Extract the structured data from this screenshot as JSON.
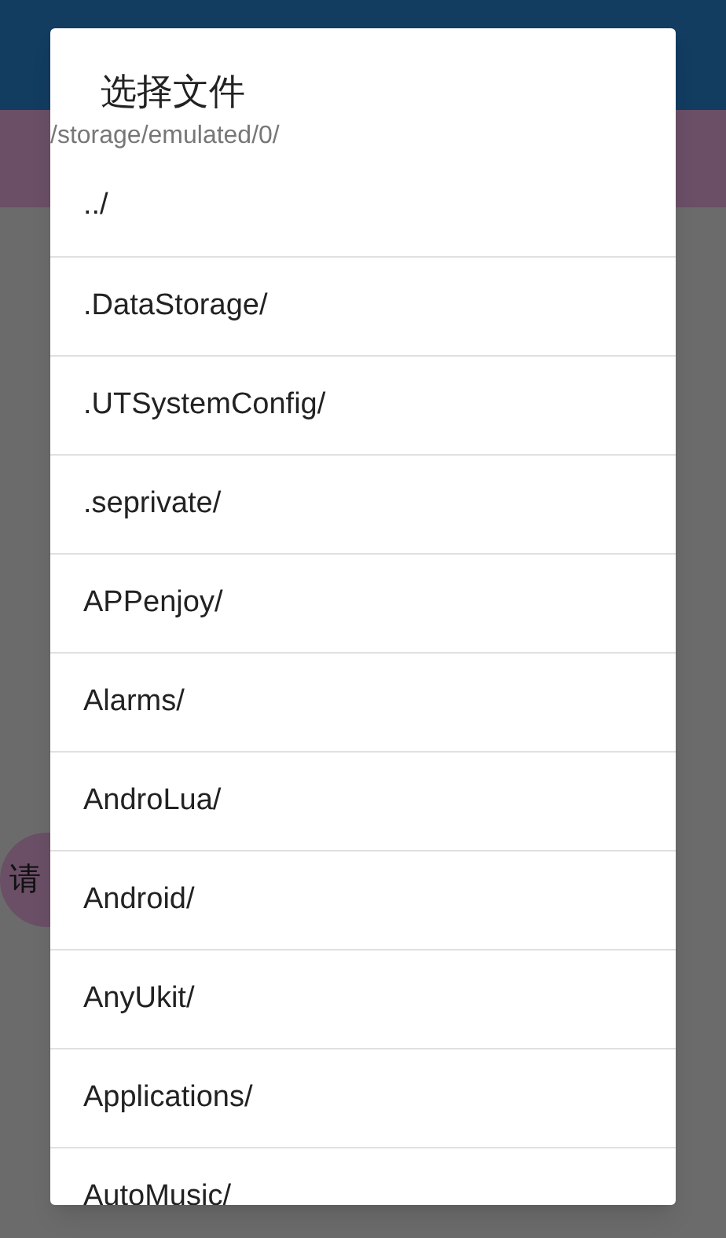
{
  "background": {
    "button_text": "请"
  },
  "dialog": {
    "title": "选择文件",
    "path": "/storage/emulated/0/",
    "items": [
      "../",
      ".DataStorage/",
      ".UTSystemConfig/",
      ".seprivate/",
      "APPenjoy/",
      "Alarms/",
      "AndroLua/",
      "Android/",
      "AnyUkit/",
      "Applications/",
      "AutoMusic/"
    ]
  }
}
